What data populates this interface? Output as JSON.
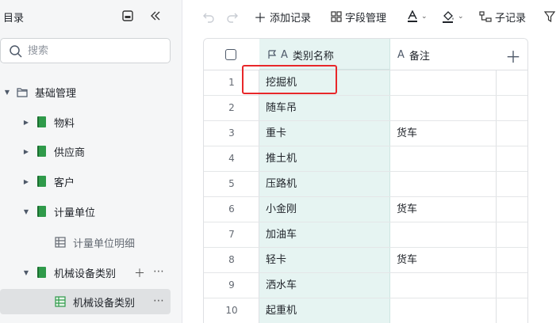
{
  "sidebar": {
    "title": "目录",
    "search_placeholder": "搜索",
    "items": [
      {
        "label": "基础管理",
        "icon": "folder-icon"
      },
      {
        "label": "物料",
        "icon": "book-icon"
      },
      {
        "label": "供应商",
        "icon": "book-icon"
      },
      {
        "label": "客户",
        "icon": "book-icon"
      },
      {
        "label": "计量单位",
        "icon": "book-icon"
      },
      {
        "label": "计量单位明细",
        "icon": "table-icon"
      },
      {
        "label": "机械设备类别",
        "icon": "book-icon"
      },
      {
        "label": "机械设备类别",
        "icon": "table-icon"
      }
    ]
  },
  "toolbar": {
    "add_record": "添加记录",
    "field_manage": "字段管理",
    "sub_record": "子记录"
  },
  "grid": {
    "columns": [
      {
        "label": "类别名称"
      },
      {
        "label": "备注"
      }
    ],
    "rows": [
      {
        "num": "1",
        "name": "挖掘机",
        "note": ""
      },
      {
        "num": "2",
        "name": "随车吊",
        "note": ""
      },
      {
        "num": "3",
        "name": "重卡",
        "note": "货车"
      },
      {
        "num": "4",
        "name": "推土机",
        "note": ""
      },
      {
        "num": "5",
        "name": "压路机",
        "note": ""
      },
      {
        "num": "6",
        "name": "小金刚",
        "note": "货车"
      },
      {
        "num": "7",
        "name": "加油车",
        "note": ""
      },
      {
        "num": "8",
        "name": "轻卡",
        "note": "货车"
      },
      {
        "num": "9",
        "name": "洒水车",
        "note": ""
      },
      {
        "num": "10",
        "name": "起重机",
        "note": ""
      }
    ]
  },
  "colors": {
    "accent_column": "#e6f4f2",
    "highlight": "#e8272a",
    "book_green": "#2f9a4a"
  }
}
